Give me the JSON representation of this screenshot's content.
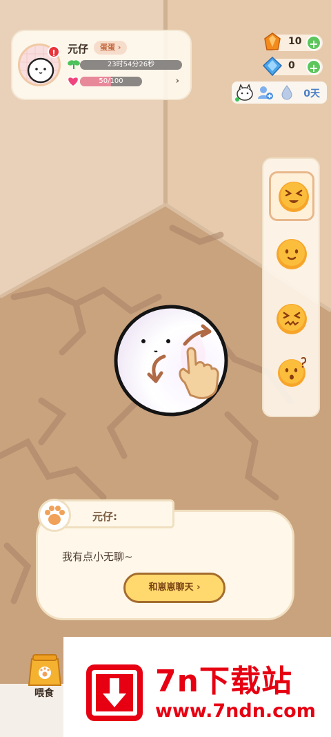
{
  "profile": {
    "name": "元仔",
    "stage": "蛋蛋",
    "stage_arrow": "›",
    "timer": "23时54分26秒",
    "hearts": "50/100",
    "hearts_fraction": 0.5,
    "alert": "!",
    "arrow": "›"
  },
  "currencies": [
    {
      "icon": "orange-gem-icon",
      "count": "10",
      "plus": "+"
    },
    {
      "icon": "blue-diamond-icon",
      "count": "0",
      "plus": "+"
    }
  ],
  "status": {
    "days": "0天"
  },
  "moods": [
    {
      "icon": "laughing-face-icon",
      "active": true
    },
    {
      "icon": "smiling-face-icon",
      "active": false
    },
    {
      "icon": "grimacing-face-icon",
      "active": false
    },
    {
      "icon": "confused-face-icon",
      "active": false
    }
  ],
  "dialog": {
    "speaker": "元仔:",
    "message": "我有点小无聊~",
    "chat_button": "和崽崽聊天 ›"
  },
  "bottom": {
    "feed_label": "喂食"
  },
  "watermark": {
    "title": "7n下载站",
    "url": "www.7ndn.com"
  },
  "colors": {
    "accent": "#ffd86e",
    "brand_red": "#e60012",
    "plus_green": "#5cc65c"
  }
}
